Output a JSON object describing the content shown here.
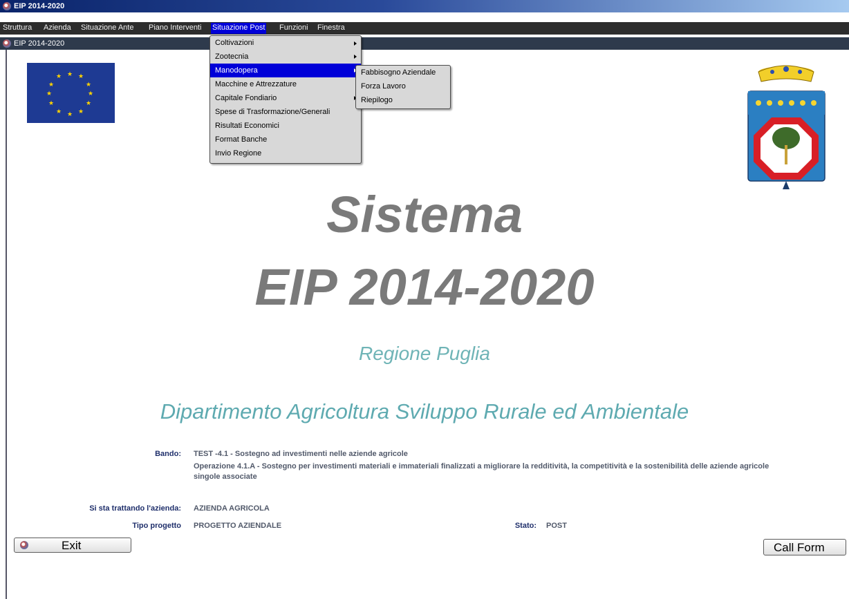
{
  "window": {
    "title": "EIP 2014-2020",
    "inner_title": "EIP 2014-2020"
  },
  "menubar": [
    {
      "label": "Struttura"
    },
    {
      "label": "Azienda"
    },
    {
      "label": "Situazione Ante"
    },
    {
      "label": "Piano Interventi"
    },
    {
      "label": "Situazione Post",
      "active": true
    },
    {
      "label": "Funzioni"
    },
    {
      "label": "Finestra"
    }
  ],
  "dropdown": {
    "items": [
      {
        "label": "Coltivazioni",
        "submenu": true
      },
      {
        "label": "Zootecnia",
        "submenu": true
      },
      {
        "label": "Manodopera",
        "submenu": true,
        "selected": true
      },
      {
        "label": "Macchine e Attrezzature"
      },
      {
        "label": "Capitale Fondiario",
        "submenu": true
      },
      {
        "label": "Spese di Trasformazione/Generali"
      },
      {
        "label": "Risultati Economici"
      },
      {
        "label": "Format Banche"
      },
      {
        "label": "Invio Regione"
      }
    ]
  },
  "submenu": {
    "items": [
      {
        "label": "Fabbisogno Aziendale"
      },
      {
        "label": "Forza Lavoro"
      },
      {
        "label": "Riepilogo"
      }
    ]
  },
  "main": {
    "heading1": "Sistema",
    "heading2": "EIP 2014-2020",
    "region": "Regione Puglia",
    "department": "Dipartimento Agricoltura Sviluppo Rurale ed Ambientale"
  },
  "info": {
    "bando_label": "Bando:",
    "bando_line1": "TEST -4.1 - Sostegno ad investimenti nelle aziende agricole",
    "bando_line2": "Operazione 4.1.A - Sostegno per investimenti materiali e immateriali finalizzati a migliorare la redditività, la competitività e la sostenibilità delle aziende agricole",
    "bando_line3": "singole associate",
    "azienda_label": "Si sta trattando l'azienda:",
    "azienda_value": "AZIENDA AGRICOLA",
    "tipo_label": "Tipo progetto",
    "tipo_value": "PROGETTO AZIENDALE",
    "stato_label": "Stato:",
    "stato_value": "POST"
  },
  "buttons": {
    "exit": "Exit",
    "call_form": "Call Form"
  },
  "colors": {
    "menu_highlight": "#0000d8",
    "heading_gray": "#7a7a7a",
    "teal": "#5eaab0",
    "label_blue": "#1f2f6b"
  }
}
